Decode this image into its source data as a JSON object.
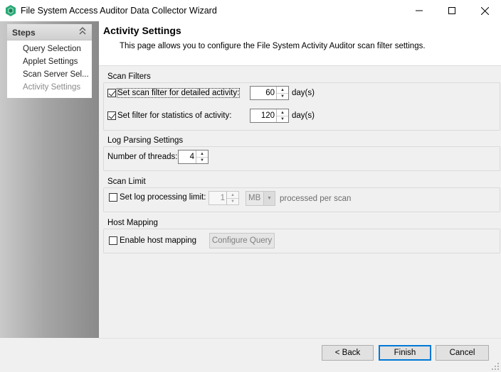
{
  "window": {
    "title": "File System Access Auditor Data Collector Wizard",
    "controls": {
      "minimize_icon": "minimize-icon",
      "maximize_icon": "maximize-icon",
      "close_icon": "close-icon"
    }
  },
  "sidebar": {
    "header": "Steps",
    "steps": [
      {
        "label": "Query Selection",
        "active": false
      },
      {
        "label": "Applet Settings",
        "active": false
      },
      {
        "label": "Scan Server Sel...",
        "active": false
      },
      {
        "label": "Activity Settings",
        "active": true
      }
    ]
  },
  "page": {
    "title": "Activity Settings",
    "description": "This page allows you to configure the File System Activity Auditor scan filter settings."
  },
  "scan_filters": {
    "label": "Scan Filters",
    "detailed": {
      "checked": true,
      "label": "Set scan filter for detailed activity:",
      "value": "60",
      "unit": "day(s)"
    },
    "statistics": {
      "checked": true,
      "label": "Set filter for statistics of activity:",
      "value": "120",
      "unit": "day(s)"
    }
  },
  "log_parsing": {
    "label": "Log Parsing Settings",
    "threads_label": "Number of threads:",
    "threads_value": "4"
  },
  "scan_limit": {
    "label": "Scan Limit",
    "checkbox_label": "Set log processing limit:",
    "checked": false,
    "value": "1",
    "unit_selected": "MB",
    "suffix": "processed per scan"
  },
  "host_mapping": {
    "label": "Host Mapping",
    "checkbox_label": "Enable host mapping",
    "checked": false,
    "button_label": "Configure Query"
  },
  "footer": {
    "back_label": "< Back",
    "finish_label": "Finish",
    "cancel_label": "Cancel"
  },
  "colors": {
    "accent": "#0078d7",
    "app_icon": "#2aa876"
  }
}
